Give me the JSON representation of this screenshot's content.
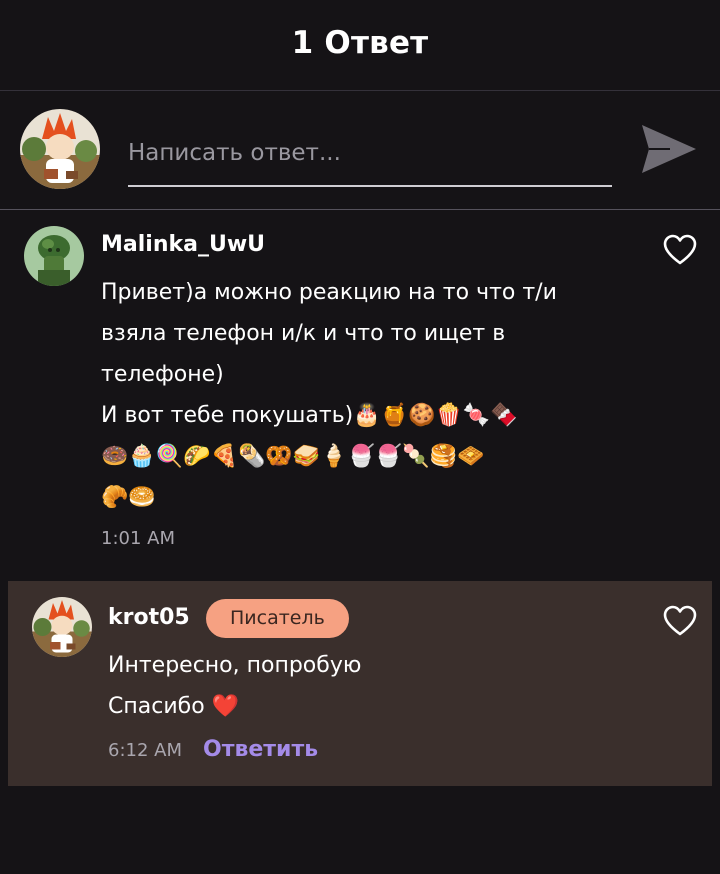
{
  "header": {
    "title": "1 Ответ"
  },
  "composer": {
    "placeholder": "Написать ответ...",
    "value": ""
  },
  "comment": {
    "username": "Malinka_UwU",
    "text": "Привет)а можно реакцию на то что т/и\nвзяла телефон и/к и что то ищет в\nтелефоне)\nИ вот тебе покушать)🎂🍯🍪🍿🍬🍫\n🍩🧁🍭🌮🍕🌯🥨🥪🍦🍧🍧🍡🥞🧇\n🥐🥯",
    "time": "1:01 AM"
  },
  "reply": {
    "username": "krot05",
    "badge": "Писатель",
    "text": "Интересно, попробую\nСпасибо ❤️",
    "time": "6:12 AM",
    "reply_label": "Ответить"
  },
  "colors": {
    "background": "#151316",
    "reply_card": "#3a2f2c",
    "badge": "#f6a182",
    "reply_link": "#a48be8",
    "muted_text": "#a9a6ae"
  },
  "icons": {
    "send": "send-icon",
    "like": "heart-outline-icon"
  }
}
